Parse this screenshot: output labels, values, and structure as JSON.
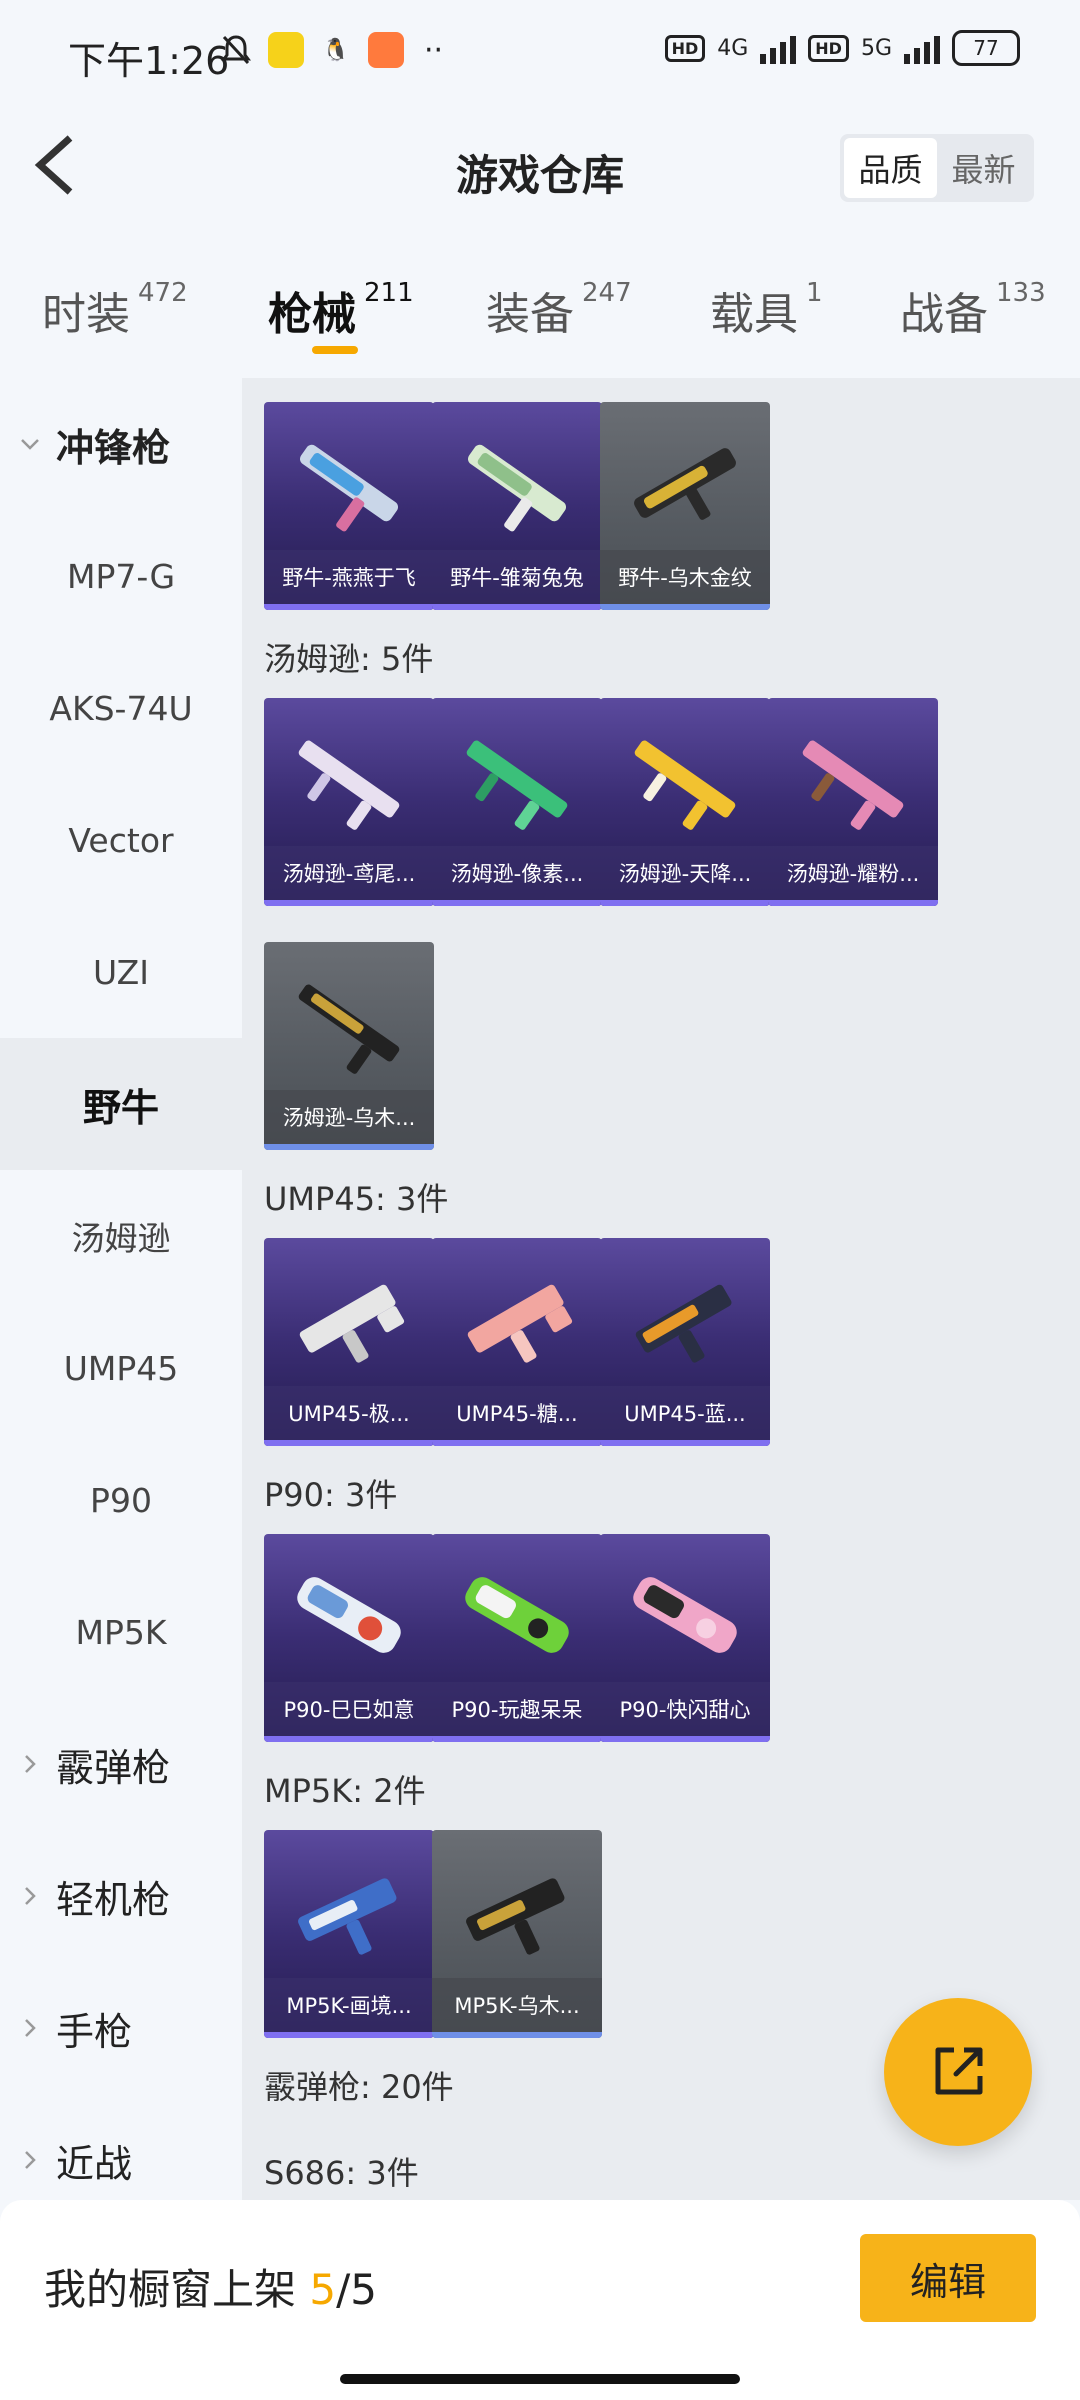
{
  "status_bar": {
    "time": "下午1:26",
    "net1": "4G",
    "net2": "5G",
    "hd": "HD",
    "battery": "77"
  },
  "header": {
    "title": "游戏仓库",
    "sort_options": [
      "品质",
      "最新"
    ],
    "sort_selected": "品质"
  },
  "tabs": [
    {
      "label": "时装",
      "count": "472"
    },
    {
      "label": "枪械",
      "count": "211",
      "active": true
    },
    {
      "label": "装备",
      "count": "247"
    },
    {
      "label": "载具",
      "count": "1"
    },
    {
      "label": "战备",
      "count": "133"
    }
  ],
  "sidebar": {
    "items": [
      {
        "label": "冲锋枪"
      },
      {
        "label": "MP7-G"
      },
      {
        "label": "AKS-74U"
      },
      {
        "label": "Vector"
      },
      {
        "label": "UZI"
      },
      {
        "label": "野牛"
      },
      {
        "label": "汤姆逊"
      },
      {
        "label": "UMP45"
      },
      {
        "label": "P90"
      },
      {
        "label": "MP5K"
      },
      {
        "label": "霰弹枪"
      },
      {
        "label": "轻机枪"
      },
      {
        "label": "手枪"
      },
      {
        "label": "近战"
      }
    ]
  },
  "content": {
    "groups": [
      {
        "title": "",
        "items": [
          {
            "name": "野牛-燕燕于飞",
            "style": "purple"
          },
          {
            "name": "野牛-雏菊兔兔",
            "style": "purple"
          },
          {
            "name": "野牛-乌木金纹",
            "style": "gray"
          }
        ]
      },
      {
        "title": "汤姆逊: 5件",
        "items": [
          {
            "name": "汤姆逊-鸢尾...",
            "style": "purple"
          },
          {
            "name": "汤姆逊-像素...",
            "style": "purple"
          },
          {
            "name": "汤姆逊-天降...",
            "style": "purple"
          },
          {
            "name": "汤姆逊-耀粉...",
            "style": "purple"
          },
          {
            "name": "汤姆逊-乌木...",
            "style": "gray"
          }
        ]
      },
      {
        "title": "UMP45: 3件",
        "items": [
          {
            "name": "UMP45-极...",
            "style": "purple"
          },
          {
            "name": "UMP45-糖...",
            "style": "purple"
          },
          {
            "name": "UMP45-蓝...",
            "style": "purple"
          }
        ]
      },
      {
        "title": "P90: 3件",
        "items": [
          {
            "name": "P90-巳巳如意",
            "style": "purple"
          },
          {
            "name": "P90-玩趣呆呆",
            "style": "purple"
          },
          {
            "name": "P90-快闪甜心",
            "style": "purple"
          }
        ]
      },
      {
        "title": "MP5K: 2件",
        "items": [
          {
            "name": "MP5K-画境...",
            "style": "purple"
          },
          {
            "name": "MP5K-乌木...",
            "style": "gray"
          }
        ]
      }
    ],
    "more_sections": [
      "霰弹枪: 20件",
      "S686: 3件"
    ]
  },
  "bottom": {
    "label": "我的橱窗上架",
    "current": "5",
    "sep": "/",
    "total": "5",
    "edit_label": "编辑"
  }
}
